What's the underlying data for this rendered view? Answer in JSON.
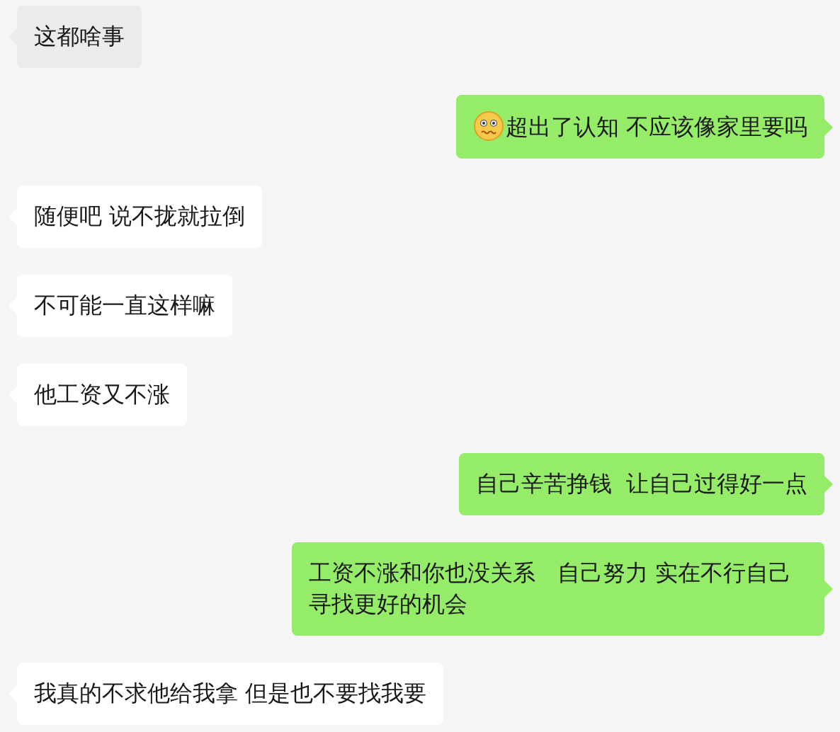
{
  "messages": [
    {
      "kind": "received",
      "text": "这都啥事",
      "highlighted": true
    },
    {
      "kind": "sent",
      "text": "超出了认知 不应该像家里要吗",
      "emoji": true
    },
    {
      "kind": "received",
      "text": "随便吧 说不拢就拉倒",
      "highlighted": false
    },
    {
      "kind": "received",
      "text": "不可能一直这样嘛",
      "highlighted": false
    },
    {
      "kind": "received",
      "text": "他工资又不涨",
      "highlighted": false
    },
    {
      "kind": "sent",
      "text": "自己辛苦挣钱  让自己过得好一点",
      "emoji": false
    },
    {
      "kind": "sent",
      "text": "工资不涨和你也没关系   自己努力 实在不行自己寻找更好的机会",
      "emoji": false
    },
    {
      "kind": "received",
      "text": "我真的不求他给我拿 但是也不要找我要",
      "highlighted": false
    }
  ]
}
